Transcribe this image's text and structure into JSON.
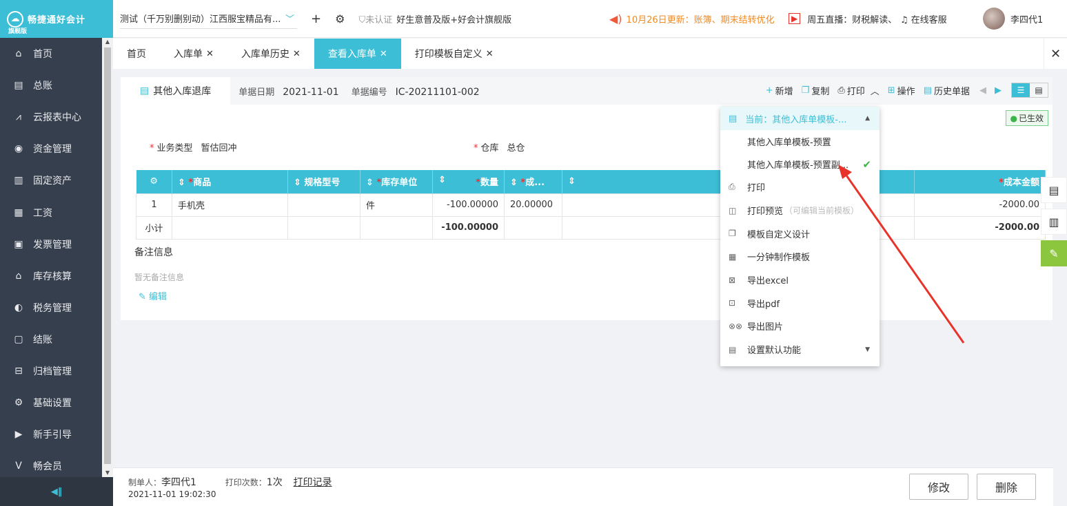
{
  "app": {
    "logo_name": "畅捷通好会计",
    "edition": "旗舰版"
  },
  "sidebar": {
    "items": [
      {
        "label": "首页",
        "icon": "home-icon"
      },
      {
        "label": "总账",
        "icon": "ledger-icon"
      },
      {
        "label": "云报表中心",
        "icon": "chart-icon"
      },
      {
        "label": "资金管理",
        "icon": "money-icon"
      },
      {
        "label": "固定资产",
        "icon": "asset-icon"
      },
      {
        "label": "工资",
        "icon": "salary-icon"
      },
      {
        "label": "发票管理",
        "icon": "invoice-icon"
      },
      {
        "label": "库存核算",
        "icon": "warehouse-icon"
      },
      {
        "label": "税务管理",
        "icon": "tax-icon"
      },
      {
        "label": "结账",
        "icon": "closing-icon"
      },
      {
        "label": "归档管理",
        "icon": "archive-icon"
      },
      {
        "label": "基础设置",
        "icon": "settings-icon"
      },
      {
        "label": "新手引导",
        "icon": "guide-icon"
      },
      {
        "label": "畅会员",
        "icon": "vip-icon"
      }
    ],
    "collapse_glyph": "◀‖"
  },
  "topbar": {
    "company": "测试（千万别删别动）江西服宝精品有...",
    "cert": "未认证",
    "version": "好生意普及版+好会计旗舰版",
    "notice": "10月26日更新：账簿、期末结转优化",
    "live": "周五直播：财税解读、",
    "service": "在线客服",
    "user": "李四代1"
  },
  "tabs": [
    {
      "label": "首页",
      "closable": false,
      "active": false
    },
    {
      "label": "入库单",
      "closable": true,
      "active": false
    },
    {
      "label": "入库单历史",
      "closable": true,
      "active": false
    },
    {
      "label": "查看入库单",
      "closable": true,
      "active": true
    },
    {
      "label": "打印模板自定义",
      "closable": true,
      "active": false
    }
  ],
  "doc": {
    "type_tab": "其他入库退库",
    "date_label": "单据日期",
    "date": "2021-11-01",
    "no_label": "单据编号",
    "no": "IC-20211101-002",
    "status": "已生效",
    "biz_type_label": "业务类型",
    "biz_type": "暂估回冲",
    "warehouse_label": "仓库",
    "warehouse": "总仓"
  },
  "toolbar": {
    "new": "新增",
    "copy": "复制",
    "print": "打印",
    "ops": "操作",
    "history": "历史单据"
  },
  "table": {
    "headers": [
      "商品",
      "规格型号",
      "库存单位",
      "数量",
      "成...",
      "成本金额"
    ],
    "rows": [
      {
        "idx": "1",
        "product": "手机壳",
        "spec": "",
        "unit": "件",
        "qty": "-100.00000",
        "cost": "20.00000",
        "amount": "-2000.00"
      }
    ],
    "subtotal": {
      "label": "小计",
      "qty": "-100.00000",
      "amount": "-2000.00"
    }
  },
  "remark": {
    "title": "备注信息",
    "empty": "暂无备注信息",
    "edit": "编辑"
  },
  "dropdown": {
    "current": "当前：其他入库单模板-...",
    "options": [
      {
        "label": "其他入库单模板-预置",
        "checked": false
      },
      {
        "label": "其他入库单模板-预置副...",
        "checked": true
      }
    ],
    "items": [
      {
        "label": "打印",
        "hint": ""
      },
      {
        "label": "打印预览",
        "hint": "（可编辑当前模板）"
      },
      {
        "label": "模板自定义设计",
        "hint": ""
      },
      {
        "label": "一分钟制作模板",
        "hint": ""
      },
      {
        "label": "导出excel",
        "hint": ""
      },
      {
        "label": "导出pdf",
        "hint": ""
      },
      {
        "label": "导出图片",
        "hint": ""
      },
      {
        "label": "设置默认功能",
        "hint": ""
      }
    ]
  },
  "footer": {
    "maker_label": "制单人：",
    "maker": "李四代1",
    "print_count_label": "打印次数：",
    "print_count": "1次",
    "print_record": "打印记录",
    "datetime": "2021-11-01 19:02:30",
    "modify": "修改",
    "delete": "删除"
  },
  "colors": {
    "accent": "#3cbfd6",
    "sidebar": "#363f4d",
    "annotation_arrow": "#e8332a",
    "ok": "#3bb54a"
  }
}
